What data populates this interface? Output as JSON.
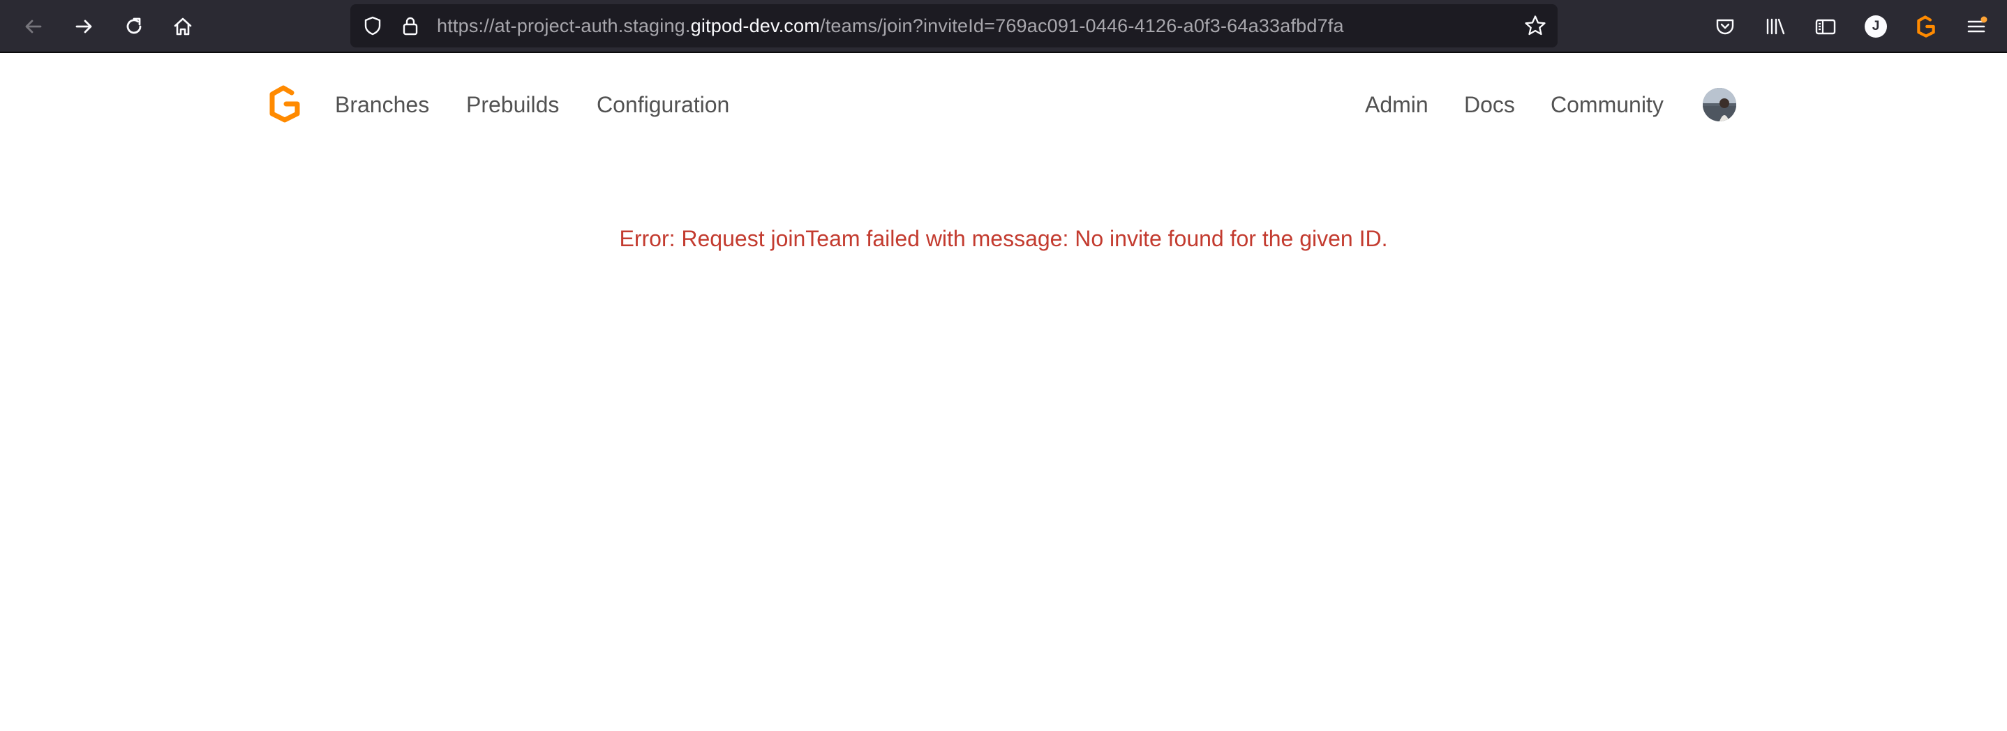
{
  "browser": {
    "url": {
      "prefix": "https://at-project-auth.staging.",
      "host": "gitpod-dev.com",
      "path": "/teams/join?inviteId=769ac091-0446-4126-a0f3-64a33afbd7fa"
    },
    "extension_badge_letter": "J",
    "icons": [
      "back-icon",
      "forward-icon",
      "reload-icon",
      "home-icon",
      "shield-icon",
      "lock-icon",
      "bookmark-star-icon",
      "pocket-icon",
      "library-icon",
      "sidebar-icon",
      "gitpod-extension-icon",
      "menu-icon"
    ]
  },
  "nav": {
    "left": [
      "Branches",
      "Prebuilds",
      "Configuration"
    ],
    "right": [
      "Admin",
      "Docs",
      "Community"
    ]
  },
  "colors": {
    "brand_orange": "#ff8a00",
    "toolbar_bg": "#2b2a33",
    "error_red": "#c33b2f",
    "nav_text": "#525252"
  },
  "main": {
    "error": "Error: Request joinTeam failed with message: No invite found for the given ID."
  }
}
